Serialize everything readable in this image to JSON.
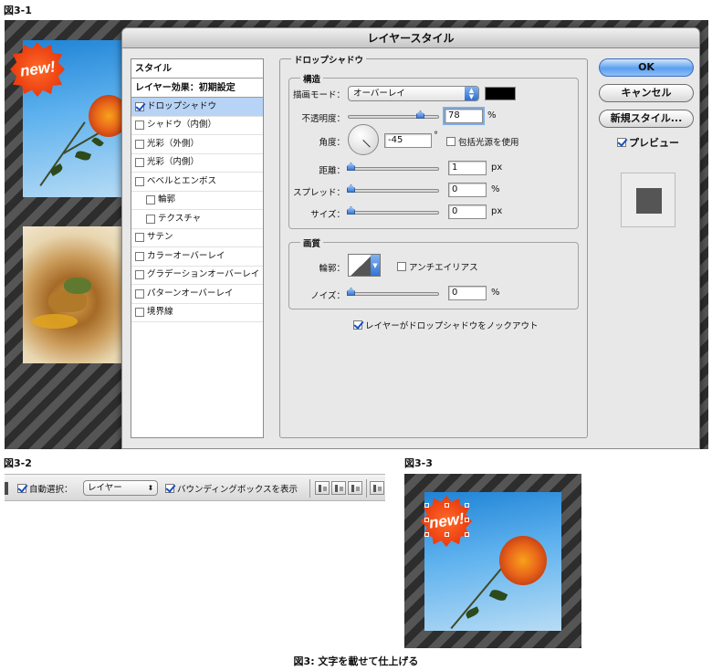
{
  "figures": {
    "fig1_label": "図3-1",
    "fig2_label": "図3-2",
    "fig3_label": "図3-3",
    "caption": "図3: 文字を載せて仕上げる"
  },
  "badge": {
    "text": "new!"
  },
  "dialog": {
    "title": "レイヤースタイル",
    "styles_header": "スタイル",
    "effects_header": "レイヤー効果：初期設定",
    "effects": [
      {
        "label": "ドロップシャドウ",
        "checked": true,
        "selected": true,
        "indent": false
      },
      {
        "label": "シャドウ（内側）",
        "checked": false,
        "selected": false,
        "indent": false
      },
      {
        "label": "光彩（外側）",
        "checked": false,
        "selected": false,
        "indent": false
      },
      {
        "label": "光彩（内側）",
        "checked": false,
        "selected": false,
        "indent": false
      },
      {
        "label": "ベベルとエンボス",
        "checked": false,
        "selected": false,
        "indent": false
      },
      {
        "label": "輪郭",
        "checked": false,
        "selected": false,
        "indent": true
      },
      {
        "label": "テクスチャ",
        "checked": false,
        "selected": false,
        "indent": true
      },
      {
        "label": "サテン",
        "checked": false,
        "selected": false,
        "indent": false
      },
      {
        "label": "カラーオーバーレイ",
        "checked": false,
        "selected": false,
        "indent": false
      },
      {
        "label": "グラデーションオーバーレイ",
        "checked": false,
        "selected": false,
        "indent": false
      },
      {
        "label": "パターンオーバーレイ",
        "checked": false,
        "selected": false,
        "indent": false
      },
      {
        "label": "境界線",
        "checked": false,
        "selected": false,
        "indent": false
      }
    ],
    "panel_title": "ドロップシャドウ",
    "structure": {
      "legend": "構造",
      "blend_mode_label": "描画モード：",
      "blend_mode_value": "オーバーレイ",
      "blend_color": "#000000",
      "opacity_label": "不透明度：",
      "opacity_value": "78",
      "opacity_unit": "%",
      "angle_label": "角度：",
      "angle_value": "-45",
      "angle_unit": "°",
      "global_light_label": "包括光源を使用",
      "distance_label": "距離：",
      "distance_value": "1",
      "distance_unit": "px",
      "spread_label": "スプレッド：",
      "spread_value": "0",
      "spread_unit": "%",
      "size_label": "サイズ：",
      "size_value": "0",
      "size_unit": "px"
    },
    "quality": {
      "legend": "画質",
      "contour_label": "輪郭：",
      "antialias_label": "アンチエイリアス",
      "noise_label": "ノイズ：",
      "noise_value": "0",
      "noise_unit": "%"
    },
    "knockout_label": "レイヤーがドロップシャドウをノックアウト",
    "buttons": {
      "ok": "OK",
      "cancel": "キャンセル",
      "new_style": "新規スタイル...",
      "preview": "プレビュー"
    }
  },
  "options_bar": {
    "auto_select_label": "自動選択：",
    "auto_select_value": "レイヤー",
    "bounding_box_label": "バウンディングボックスを表示"
  }
}
